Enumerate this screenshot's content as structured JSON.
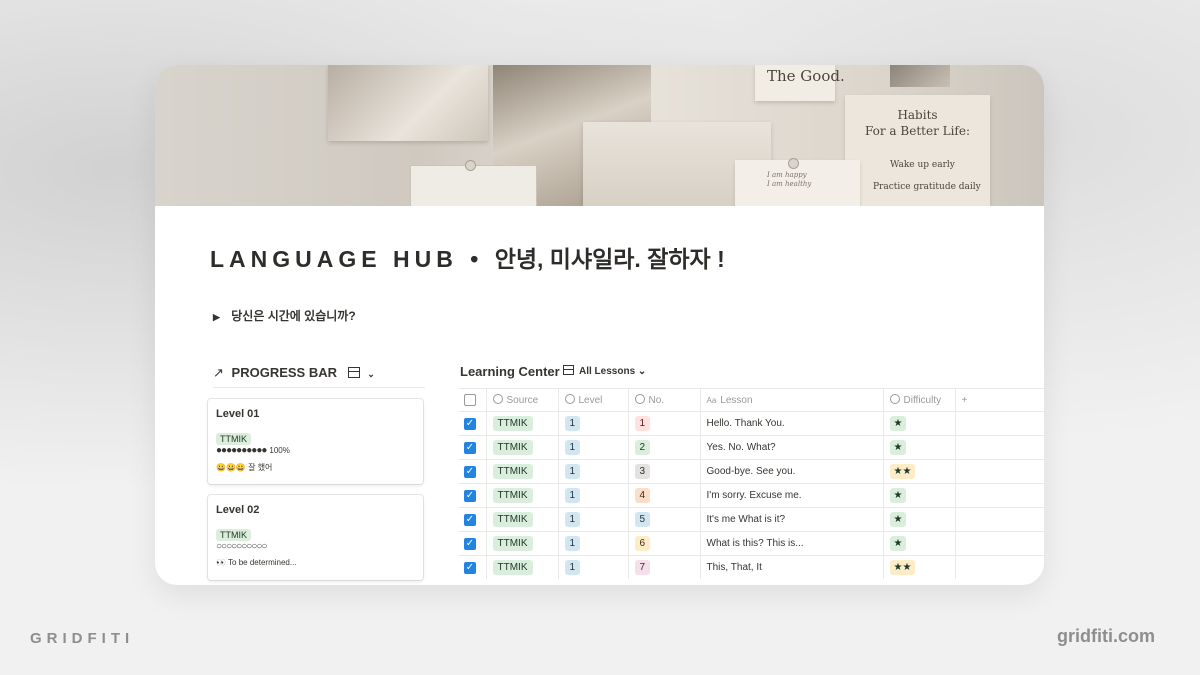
{
  "cover": {
    "the_good": "The Good.",
    "habits_line1": "Habits",
    "habits_line2": "For a Better Life:",
    "wake_up": "Wake up early",
    "practice": "Practice gratitude daily",
    "note_line1": "I am happy",
    "note_line2": "I am healthy"
  },
  "page": {
    "title_en": "LANGUAGE HUB",
    "title_separator": "•",
    "title_ko": "안녕, 미샤일라. 잘하자 !",
    "toggle_text": "당신은 시간에 있습니까?"
  },
  "progress_db": {
    "arrow": "↗",
    "title": "PROGRESS BAR",
    "cards": [
      {
        "name": "Level 01",
        "tag": "TTMIK",
        "bar": "●●●●●●●●●●",
        "percent": "100%",
        "note": "😀😀😀 잘 했어"
      },
      {
        "name": "Level 02",
        "tag": "TTMIK",
        "bar": "○○○○○○○○○○",
        "percent": "",
        "note": "👀 To be determined..."
      }
    ]
  },
  "learning_center": {
    "title": "Learning Center",
    "view": "All Lessons",
    "columns": {
      "source": "Source",
      "level": "Level",
      "no": "No.",
      "lesson": "Lesson",
      "difficulty": "Difficulty",
      "add": "+"
    },
    "rows": [
      {
        "source": "TTMIK",
        "level": "1",
        "no": "1",
        "lesson": "Hello. Thank You.",
        "difficulty": "★"
      },
      {
        "source": "TTMIK",
        "level": "1",
        "no": "2",
        "lesson": "Yes. No. What?",
        "difficulty": "★"
      },
      {
        "source": "TTMIK",
        "level": "1",
        "no": "3",
        "lesson": "Good-bye. See you.",
        "difficulty": "★★"
      },
      {
        "source": "TTMIK",
        "level": "1",
        "no": "4",
        "lesson": "I'm sorry. Excuse me.",
        "difficulty": "★"
      },
      {
        "source": "TTMIK",
        "level": "1",
        "no": "5",
        "lesson": "It's me What is it?",
        "difficulty": "★"
      },
      {
        "source": "TTMIK",
        "level": "1",
        "no": "6",
        "lesson": "What is this? This is...",
        "difficulty": "★"
      },
      {
        "source": "TTMIK",
        "level": "1",
        "no": "7",
        "lesson": "This, That, It",
        "difficulty": "★★"
      }
    ]
  },
  "footer": {
    "brand_left": "GRIDFITI",
    "brand_right": "gridfiti.com"
  },
  "colors": {
    "checkbox": "#2383e2",
    "tag_green": "#dbeddb",
    "tag_blue": "#d3e5ef",
    "star_single_bg": "#dbeddb",
    "star_double_bg": "#fdecc8",
    "background": "#f1f1f1"
  }
}
